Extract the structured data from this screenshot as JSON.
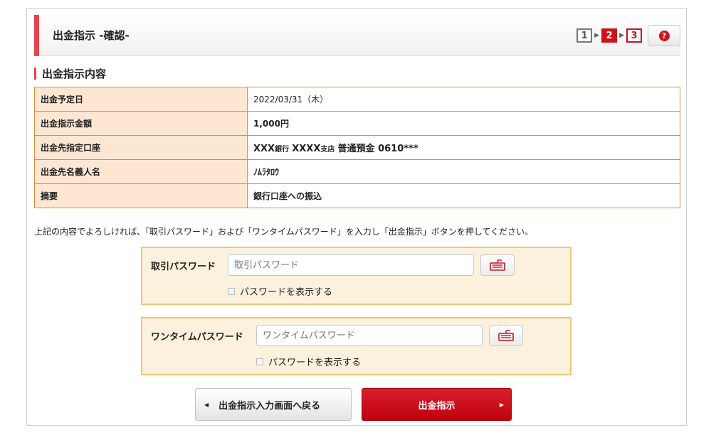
{
  "header": {
    "title": "出金指示 -確認-",
    "steps": [
      "1",
      "2",
      "3"
    ],
    "current_step": "2",
    "help_icon": "question-circle-icon"
  },
  "section": {
    "title": "出金指示内容"
  },
  "details": {
    "rows": [
      {
        "label": "出金予定日",
        "value": "2022/03/31（木）"
      },
      {
        "label": "出金指示金額",
        "value": "1,000円"
      },
      {
        "label": "出金先指定口座",
        "value": "XXX 銀行 XXXX 支店 普通預金 0610***",
        "bank_name": "XXX",
        "bank_suffix": "銀行",
        "branch_name": "XXXX",
        "branch_suffix": "支店",
        "account": "普通預金 0610***"
      },
      {
        "label": "出金先名義人名",
        "value": "ﾉﾑﾗﾀﾛｳ"
      },
      {
        "label": "摘要",
        "value": "銀行口座への振込"
      }
    ]
  },
  "instruction": "上記の内容でよろしければ、「取引パスワード」および「ワンタイムパスワード」を入力し「出金指示」ボタンを押してください。",
  "trading_password": {
    "label": "取引パスワード",
    "placeholder": "取引パスワード",
    "value": "",
    "show_label": "パスワードを表示する",
    "keyboard_icon": "software-keyboard-icon"
  },
  "onetime_password": {
    "label": "ワンタイムパスワード",
    "placeholder": "ワンタイムパスワード",
    "value": "",
    "show_label": "パスワードを表示する",
    "keyboard_icon": "software-keyboard-icon"
  },
  "buttons": {
    "back_label": "出金指示入力画面へ戻る",
    "submit_label": "出金指示"
  },
  "colors": {
    "accent_red": "#d0101d",
    "table_border": "#e28a3c",
    "label_bg": "#fde6d2",
    "password_box_bg": "#fcf1dd",
    "value_brown": "#8b4512"
  }
}
